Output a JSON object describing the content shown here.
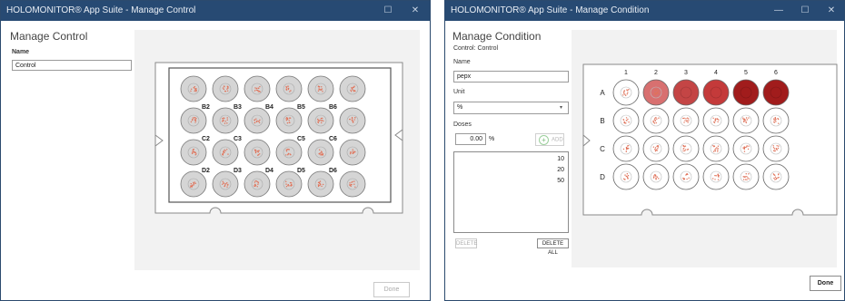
{
  "left_window": {
    "title": "HOLOMONITOR® App Suite - Manage Control",
    "minimize_glyph": "—",
    "maximize_glyph": "☐",
    "close_glyph": "✕",
    "heading": "Manage Control",
    "name_label": "Name",
    "name_value": "Control",
    "plate": {
      "visible_labels": [
        "B2",
        "B3",
        "B4",
        "B5",
        "B6",
        "C2",
        "C3",
        "C5",
        "C6",
        "D2",
        "D3",
        "D4",
        "D5",
        "D6"
      ],
      "well_fill": "#d5d5d5"
    },
    "done_label": "Done",
    "done_enabled": false
  },
  "right_window": {
    "title": "HOLOMONITOR® App Suite - Manage Condition",
    "minimize_glyph": "—",
    "maximize_glyph": "☐",
    "close_glyph": "✕",
    "heading": "Manage Condition",
    "control_text": "Control: Control",
    "name_label": "Name",
    "name_value": "pepx",
    "unit_label": "Unit",
    "unit_value": "%",
    "unit_arrow": "▾",
    "doses_label": "Doses",
    "dose_input_value": "0.00",
    "dose_unit": "%",
    "add_label": "ADD",
    "add_icon": "+",
    "doses": [
      "10",
      "20",
      "50"
    ],
    "delete_label": "DELETE",
    "delete_all_label": "DELETE ALL",
    "plate": {
      "columns": [
        "1",
        "2",
        "3",
        "4",
        "5",
        "6"
      ],
      "rows": [
        "A",
        "B",
        "C",
        "D"
      ],
      "well_colors": [
        "#ffffff",
        "#d87070",
        "#c44545",
        "#c43a3a",
        "#a11c1c",
        "#a11c1c"
      ]
    },
    "done_label": "Done"
  }
}
